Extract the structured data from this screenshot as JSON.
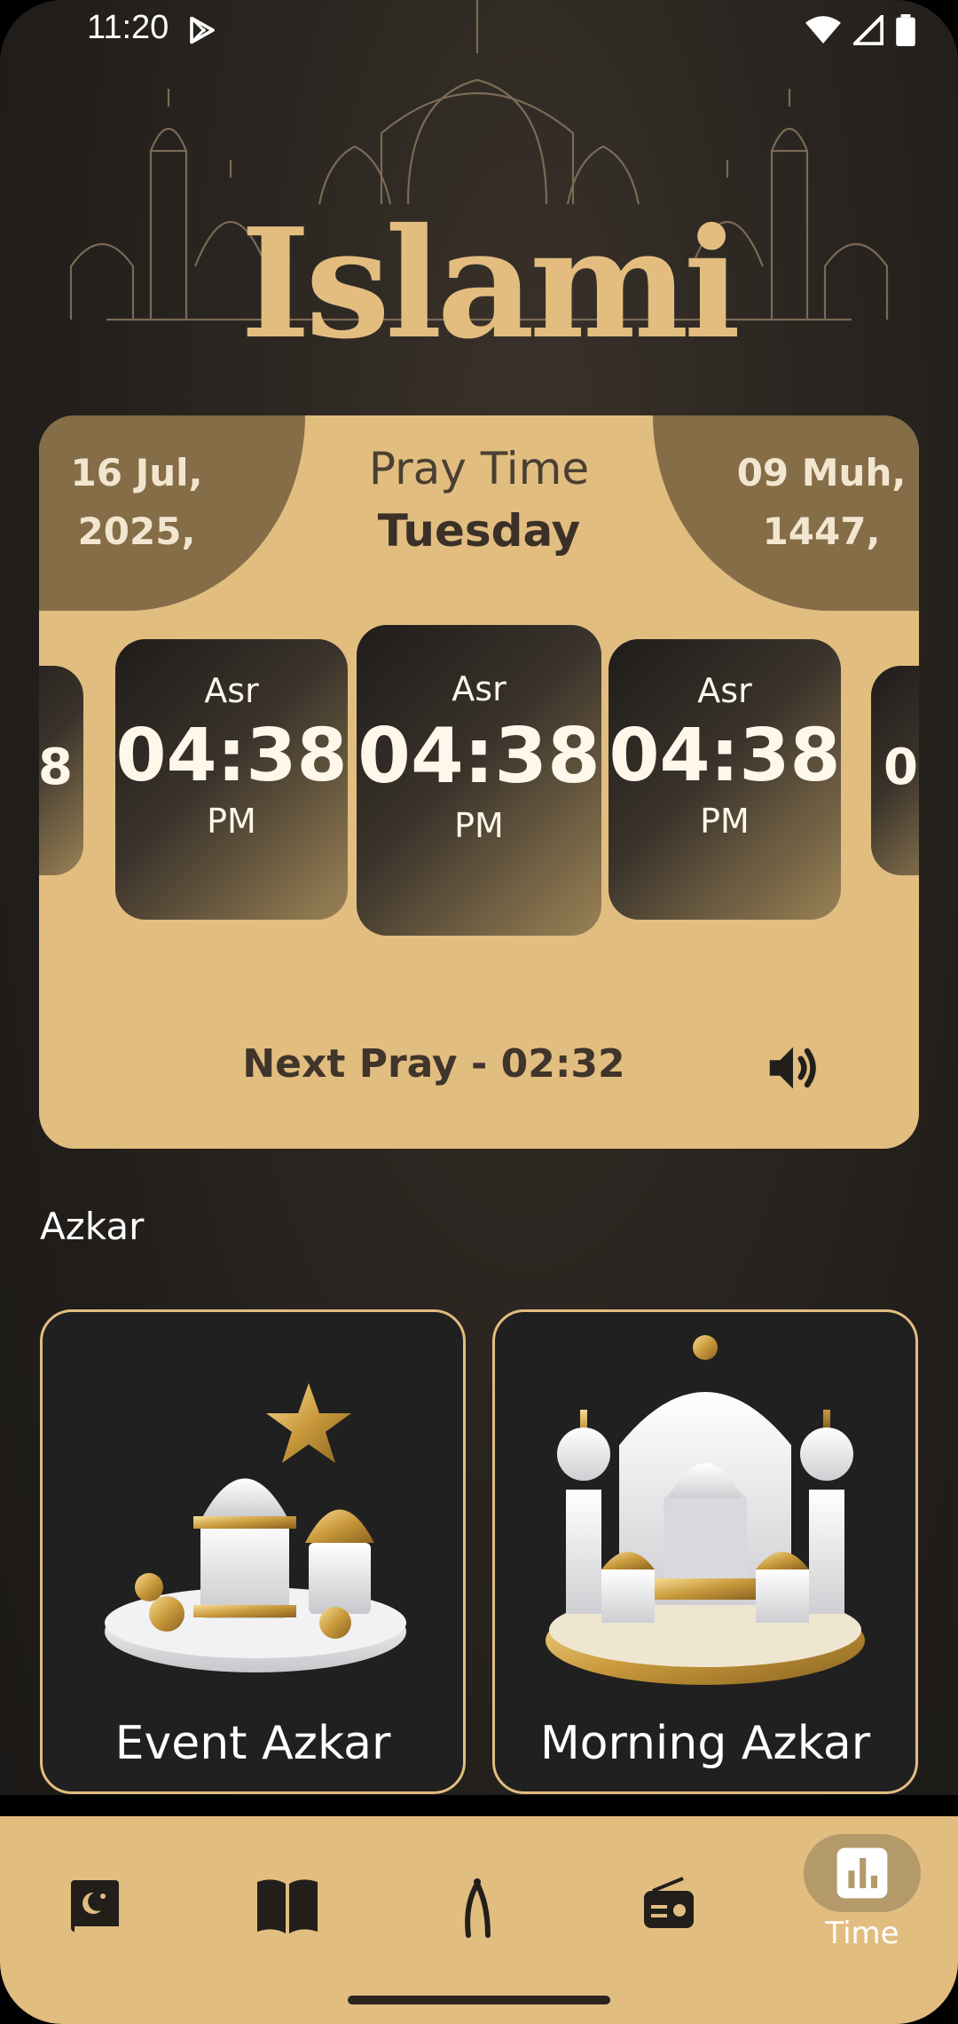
{
  "status_bar": {
    "time": "11:20"
  },
  "logo": {
    "text": "Islami"
  },
  "pray_card": {
    "gregorian_date": "16 Jul,\n2025,",
    "hijri_date": "09 Muh,\n1447,",
    "title": "Pray Time",
    "day": "Tuesday",
    "tiles": [
      {
        "name": "",
        "time": "8",
        "ampm": ""
      },
      {
        "name": "Asr",
        "time": "04:38",
        "ampm": "PM"
      },
      {
        "name": "Asr",
        "time": "04:38",
        "ampm": "PM"
      },
      {
        "name": "Asr",
        "time": "04:38",
        "ampm": "PM"
      },
      {
        "name": "",
        "time": "0",
        "ampm": ""
      }
    ],
    "next_pray": "Next Pray - 02:32"
  },
  "azkar": {
    "section_title": "Azkar",
    "cards": [
      {
        "label": "Event Azkar"
      },
      {
        "label": "Morning Azkar"
      }
    ]
  },
  "bottom_nav": {
    "items": [
      {
        "icon": "quran-icon"
      },
      {
        "icon": "book-icon"
      },
      {
        "icon": "sebha-icon"
      },
      {
        "icon": "radio-icon"
      },
      {
        "icon": "time-icon",
        "label": "Time",
        "active": true
      }
    ]
  },
  "colors": {
    "accent": "#e2bd80",
    "dark_accent": "#856d48",
    "background": "#201d1a"
  }
}
